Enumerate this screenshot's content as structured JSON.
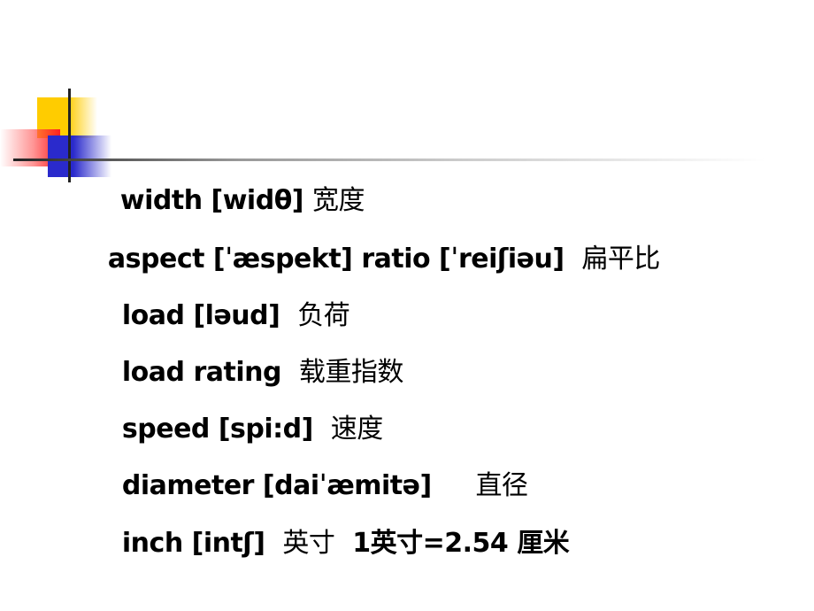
{
  "slide": {
    "lines": [
      {
        "term": "width [widθ]",
        "gap": " ",
        "meaning": "宽度"
      },
      {
        "term": "aspect [ˈæspekt] ratio [ˈreiʃiəu]",
        "gap": "  ",
        "meaning": "扁平比"
      },
      {
        "term": "load [ləud]",
        "gap": "  ",
        "meaning": "负荷"
      },
      {
        "term": "load rating",
        "gap": "  ",
        "meaning": "载重指数"
      },
      {
        "term": "speed [spi:d]",
        "gap": "  ",
        "meaning": "速度"
      },
      {
        "term": "diameter [daiˈæmitə]",
        "gap": "     ",
        "meaning": "直径"
      },
      {
        "term": "inch [intʃ]",
        "gap": "  ",
        "meaning": "英寸",
        "extra": "  1英寸=2.54 厘米"
      }
    ]
  },
  "colors": {
    "yellow": "#ffcc00",
    "red": "#ff2020",
    "blue": "#2a2acc"
  }
}
